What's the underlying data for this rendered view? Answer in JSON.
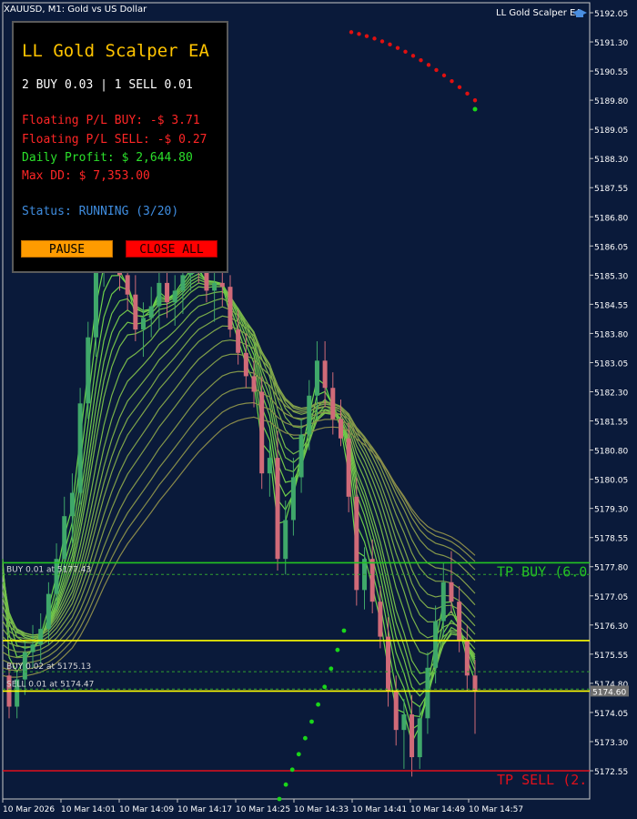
{
  "header": {
    "symbol_info": "XAUUSD, M1:  Gold vs US Dollar",
    "ea_name": "LL Gold Scalper EA"
  },
  "price_axis": {
    "ticks": [
      "5192.05",
      "5191.30",
      "5190.55",
      "5189.80",
      "5189.05",
      "5188.30",
      "5187.55",
      "5186.80",
      "5186.05",
      "5185.30",
      "5184.55",
      "5183.80",
      "5183.05",
      "5182.30",
      "5181.55",
      "5180.80",
      "5180.05",
      "5179.30",
      "5178.55",
      "5177.80",
      "5177.05",
      "5176.30",
      "5175.55",
      "5174.80",
      "5174.05",
      "5173.30",
      "5172.55"
    ],
    "current_price": "5174.60"
  },
  "time_axis": {
    "ticks": [
      "10 Mar 2026",
      "10 Mar 14:01",
      "10 Mar 14:09",
      "10 Mar 14:17",
      "10 Mar 14:25",
      "10 Mar 14:33",
      "10 Mar 14:41",
      "10 Mar 14:49",
      "10 Mar 14:57"
    ]
  },
  "levels": [
    {
      "label": "TP BUY (6.0",
      "color": "#23c423",
      "price": 5177.9
    },
    {
      "label": "TP SELL (2.",
      "color": "#e0101c",
      "price": 5172.55
    },
    {
      "label": "",
      "color": "#ffff00",
      "price": 5175.9
    },
    {
      "label": "",
      "color": "#ffff00",
      "price": 5174.6
    }
  ],
  "orders": [
    {
      "label": "BUY 0.01 at 5177.43",
      "price": 5177.6
    },
    {
      "label": "BUY 0.02 at 5175.13",
      "price": 5175.1
    },
    {
      "label": "SELL 0.01 at 5174.47",
      "price": 5174.65
    }
  ],
  "ea_panel": {
    "title": "LL Gold Scalper EA",
    "positions": "2 BUY 0.03 | 1 SELL 0.01",
    "floating_buy": "Floating P/L BUY: -$ 3.71",
    "floating_sell": "Floating P/L SELL: -$ 0.27",
    "daily_profit": "Daily Profit: $ 2,644.80",
    "max_dd": "Max DD: $ 7,353.00",
    "status": "Status: RUNNING (3/20)",
    "pause_label": "PAUSE",
    "close_all_label": "CLOSE ALL"
  },
  "colors": {
    "background": "#0a1a3a",
    "bull_candle": "#3fa86a",
    "bear_candle": "#d06a78",
    "ribbon_fast": "#6ad64a",
    "ribbon_slow": "#8a8a4a",
    "psar_up": "#1ad61a",
    "psar_down": "#e01010",
    "panel_accent": "#ffc400"
  },
  "chart_data": {
    "type": "candlestick",
    "symbol": "XAUUSD",
    "timeframe": "M1",
    "ylim": [
      5172.0,
      5192.3
    ],
    "candles": [
      [
        5175.0,
        5175.3,
        5173.9,
        5174.2
      ],
      [
        5174.2,
        5175.1,
        5173.9,
        5174.9
      ],
      [
        5174.9,
        5175.9,
        5174.5,
        5175.6
      ],
      [
        5175.6,
        5176.3,
        5175.2,
        5175.8
      ],
      [
        5175.8,
        5176.6,
        5175.3,
        5176.2
      ],
      [
        5176.2,
        5177.4,
        5175.8,
        5177.1
      ],
      [
        5177.1,
        5178.4,
        5176.7,
        5178.0
      ],
      [
        5178.0,
        5179.6,
        5177.7,
        5179.1
      ],
      [
        5179.1,
        5180.2,
        5178.4,
        5179.7
      ],
      [
        5179.7,
        5182.4,
        5179.4,
        5182.0
      ],
      [
        5182.0,
        5184.1,
        5181.6,
        5183.7
      ],
      [
        5183.7,
        5185.8,
        5183.2,
        5185.4
      ],
      [
        5185.4,
        5186.3,
        5185.0,
        5186.0
      ],
      [
        5186.0,
        5186.4,
        5185.4,
        5185.7
      ],
      [
        5185.7,
        5186.6,
        5184.9,
        5185.3
      ],
      [
        5185.3,
        5185.9,
        5184.4,
        5184.8
      ],
      [
        5184.8,
        5185.3,
        5183.6,
        5183.9
      ],
      [
        5183.9,
        5184.6,
        5183.2,
        5184.2
      ],
      [
        5184.2,
        5185.0,
        5183.7,
        5184.5
      ],
      [
        5184.5,
        5185.5,
        5183.9,
        5185.1
      ],
      [
        5185.1,
        5185.7,
        5184.2,
        5184.6
      ],
      [
        5184.6,
        5185.3,
        5184.0,
        5184.9
      ],
      [
        5184.9,
        5185.7,
        5184.3,
        5185.3
      ],
      [
        5185.3,
        5186.0,
        5184.9,
        5185.6
      ],
      [
        5185.6,
        5186.2,
        5185.1,
        5185.5
      ],
      [
        5185.5,
        5185.9,
        5184.6,
        5184.9
      ],
      [
        5184.9,
        5185.6,
        5184.1,
        5185.1
      ],
      [
        5185.1,
        5185.6,
        5184.5,
        5185.0
      ],
      [
        5185.0,
        5185.3,
        5183.7,
        5183.9
      ],
      [
        5183.9,
        5184.4,
        5183.0,
        5183.3
      ],
      [
        5183.3,
        5183.8,
        5182.4,
        5182.7
      ],
      [
        5182.7,
        5183.1,
        5181.9,
        5182.3
      ],
      [
        5182.3,
        5182.7,
        5179.8,
        5180.2
      ],
      [
        5180.2,
        5181.0,
        5179.6,
        5180.6
      ],
      [
        5180.6,
        5181.3,
        5177.7,
        5178.0
      ],
      [
        5178.0,
        5179.5,
        5177.6,
        5179.0
      ],
      [
        5179.0,
        5180.6,
        5178.6,
        5180.1
      ],
      [
        5180.1,
        5181.6,
        5179.7,
        5181.2
      ],
      [
        5181.2,
        5182.6,
        5180.8,
        5182.2
      ],
      [
        5182.2,
        5183.6,
        5181.6,
        5183.1
      ],
      [
        5183.1,
        5183.6,
        5181.9,
        5182.4
      ],
      [
        5182.4,
        5182.8,
        5181.2,
        5181.6
      ],
      [
        5181.6,
        5182.1,
        5180.9,
        5181.1
      ],
      [
        5181.1,
        5181.5,
        5179.2,
        5179.6
      ],
      [
        5179.6,
        5180.1,
        5176.8,
        5177.2
      ],
      [
        5177.2,
        5178.3,
        5176.7,
        5178.0
      ],
      [
        5178.0,
        5178.5,
        5176.6,
        5176.9
      ],
      [
        5176.9,
        5177.3,
        5175.7,
        5176.0
      ],
      [
        5176.0,
        5176.5,
        5174.2,
        5174.6
      ],
      [
        5174.6,
        5175.0,
        5173.2,
        5173.6
      ],
      [
        5173.6,
        5174.4,
        5172.6,
        5174.0
      ],
      [
        5174.0,
        5174.5,
        5172.4,
        5172.9
      ],
      [
        5172.9,
        5174.2,
        5172.6,
        5173.9
      ],
      [
        5173.9,
        5175.6,
        5173.5,
        5175.2
      ],
      [
        5175.2,
        5176.8,
        5174.8,
        5176.4
      ],
      [
        5176.4,
        5177.9,
        5176.0,
        5177.4
      ],
      [
        5177.4,
        5178.2,
        5176.6,
        5176.9
      ],
      [
        5176.9,
        5177.3,
        5175.6,
        5175.9
      ],
      [
        5175.9,
        5176.3,
        5174.6,
        5175.0
      ],
      [
        5175.0,
        5175.4,
        5173.5,
        5174.6
      ]
    ]
  }
}
